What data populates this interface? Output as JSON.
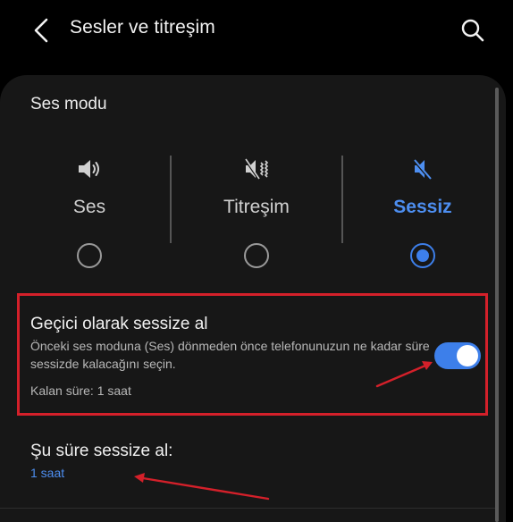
{
  "header": {
    "title": "Sesler ve titreşim",
    "back_icon": "chevron-left-icon",
    "search_icon": "search-icon"
  },
  "sound_mode": {
    "title": "Ses modu",
    "modes": [
      {
        "label": "Ses",
        "icon": "volume-icon",
        "selected": false
      },
      {
        "label": "Titreşim",
        "icon": "vibrate-icon",
        "selected": false
      },
      {
        "label": "Sessiz",
        "icon": "mute-icon",
        "selected": true
      }
    ]
  },
  "temporary_mute": {
    "title": "Geçici olarak sessize al",
    "description": "Önceki ses moduna (Ses) dönmeden önce telefonunuzun ne kadar süre sessizde kalacağını seçin.",
    "remaining": "Kalan süre: 1 saat",
    "enabled": true
  },
  "mute_duration": {
    "title": "Şu süre sessize al:",
    "value": "1 saat"
  },
  "colors": {
    "accent": "#3d7fea",
    "annotation": "#d4202a",
    "background": "#000000",
    "card": "#171717"
  }
}
